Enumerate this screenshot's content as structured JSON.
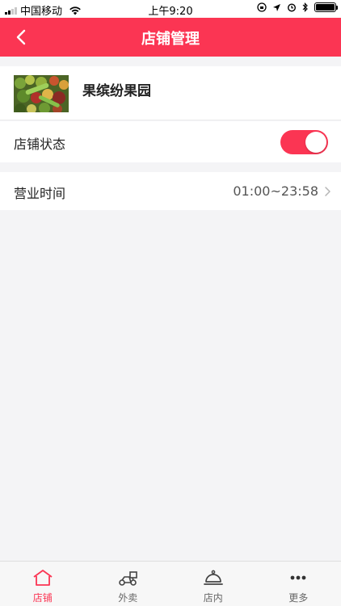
{
  "status_bar": {
    "carrier": "中国移动",
    "time": "上午9:20"
  },
  "nav": {
    "title": "店铺管理",
    "back_icon": "chevron-left-icon"
  },
  "store": {
    "name": "果缤纷果园",
    "image": "fruit-store-photo"
  },
  "status": {
    "label": "店铺状态",
    "enabled": true
  },
  "hours": {
    "label": "营业时间",
    "value": "01:00~23:58"
  },
  "tabs": [
    {
      "label": "店铺",
      "icon": "home-icon",
      "active": true
    },
    {
      "label": "外卖",
      "icon": "scooter-icon",
      "active": false
    },
    {
      "label": "店内",
      "icon": "cloche-icon",
      "active": false
    },
    {
      "label": "更多",
      "icon": "more-dots-icon",
      "active": false
    }
  ],
  "colors": {
    "accent": "#fb3553",
    "background": "#f4f4f6"
  }
}
